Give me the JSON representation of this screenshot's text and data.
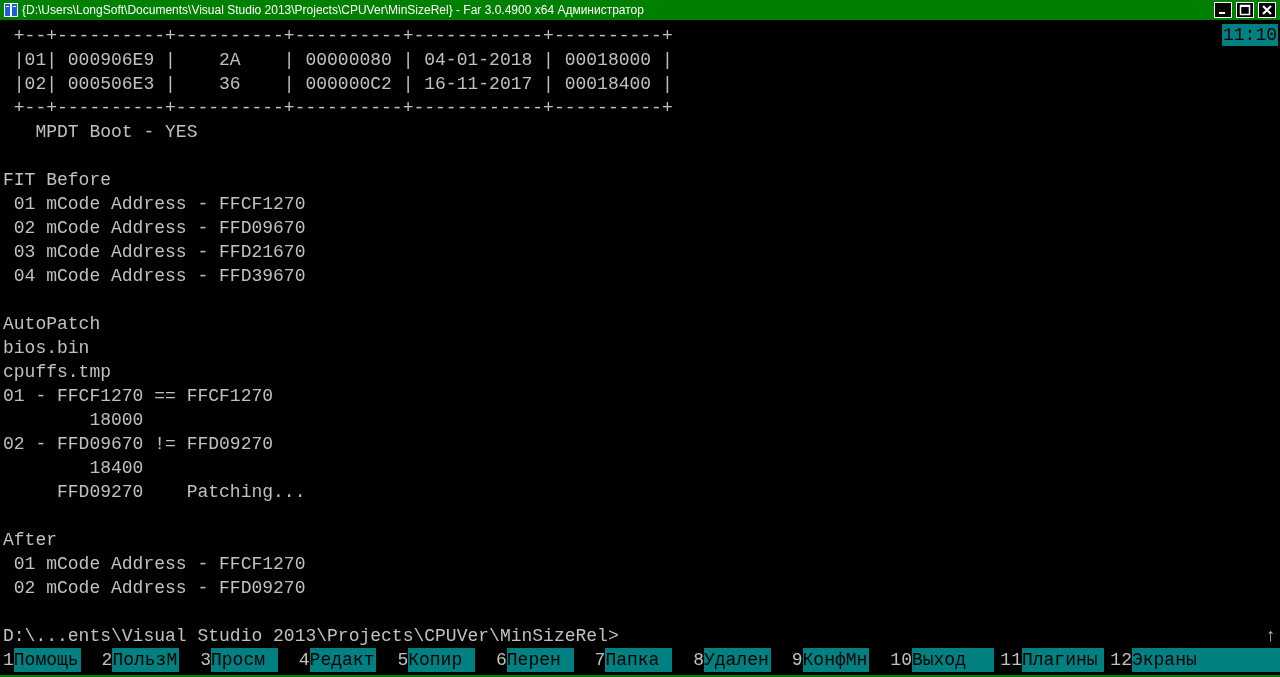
{
  "window": {
    "title": "{D:\\Users\\LongSoft\\Documents\\Visual Studio 2013\\Projects\\CPUVer\\MinSizeRel} - Far 3.0.4900 x64 Администратор"
  },
  "clock": "11:10",
  "console_lines": [
    {
      "kind": "text",
      "text": " +--+----------+----------+----------+------------+----------+"
    },
    {
      "kind": "text",
      "text": " |01| 000906E9 |    2A    | 00000080 | 04-01-2018 | 00018000 |"
    },
    {
      "kind": "text",
      "text": " |02| 000506E3 |    36    | 000000C2 | 16-11-2017 | 00018400 |"
    },
    {
      "kind": "text",
      "text": " +--+----------+----------+----------+------------+----------+"
    },
    {
      "kind": "text",
      "text": "   MPDT Boot - YES"
    },
    {
      "kind": "blank"
    },
    {
      "kind": "text",
      "text": "FIT Before"
    },
    {
      "kind": "text",
      "text": " 01 mCode Address - FFCF1270"
    },
    {
      "kind": "text",
      "text": " 02 mCode Address - FFD09670"
    },
    {
      "kind": "text",
      "text": " 03 mCode Address - FFD21670"
    },
    {
      "kind": "text",
      "text": " 04 mCode Address - FFD39670"
    },
    {
      "kind": "blank"
    },
    {
      "kind": "text",
      "text": "AutoPatch"
    },
    {
      "kind": "text",
      "text": "bios.bin"
    },
    {
      "kind": "text",
      "text": "cpuffs.tmp"
    },
    {
      "kind": "text",
      "text": "01 - FFCF1270 == FFCF1270"
    },
    {
      "kind": "text",
      "text": "        18000"
    },
    {
      "kind": "text",
      "text": "02 - FFD09670 != FFD09270"
    },
    {
      "kind": "text",
      "text": "        18400"
    },
    {
      "kind": "text",
      "text": "     FFD09270    Patching..."
    },
    {
      "kind": "blank"
    },
    {
      "kind": "text",
      "text": "After"
    },
    {
      "kind": "text",
      "text": " 01 mCode Address - FFCF1270"
    },
    {
      "kind": "text",
      "text": " 02 mCode Address - FFD09270"
    },
    {
      "kind": "blank"
    }
  ],
  "prompt": {
    "text": "D:\\...ents\\Visual Studio 2013\\Projects\\CPUVer\\MinSizeRel>",
    "scroll_mark": "↑"
  },
  "keybar": [
    {
      "key": "1",
      "label": "Помощь"
    },
    {
      "key": "2",
      "label": "ПользМ"
    },
    {
      "key": "3",
      "label": "Просм"
    },
    {
      "key": "4",
      "label": "Редакт"
    },
    {
      "key": "5",
      "label": "Копир"
    },
    {
      "key": "6",
      "label": "Перен"
    },
    {
      "key": "7",
      "label": "Папка"
    },
    {
      "key": "8",
      "label": "Удален"
    },
    {
      "key": "9",
      "label": "КонфМн"
    },
    {
      "key": "10",
      "label": "Выход"
    },
    {
      "key": "11",
      "label": "Плагины"
    },
    {
      "key": "12",
      "label": "Экраны"
    }
  ]
}
